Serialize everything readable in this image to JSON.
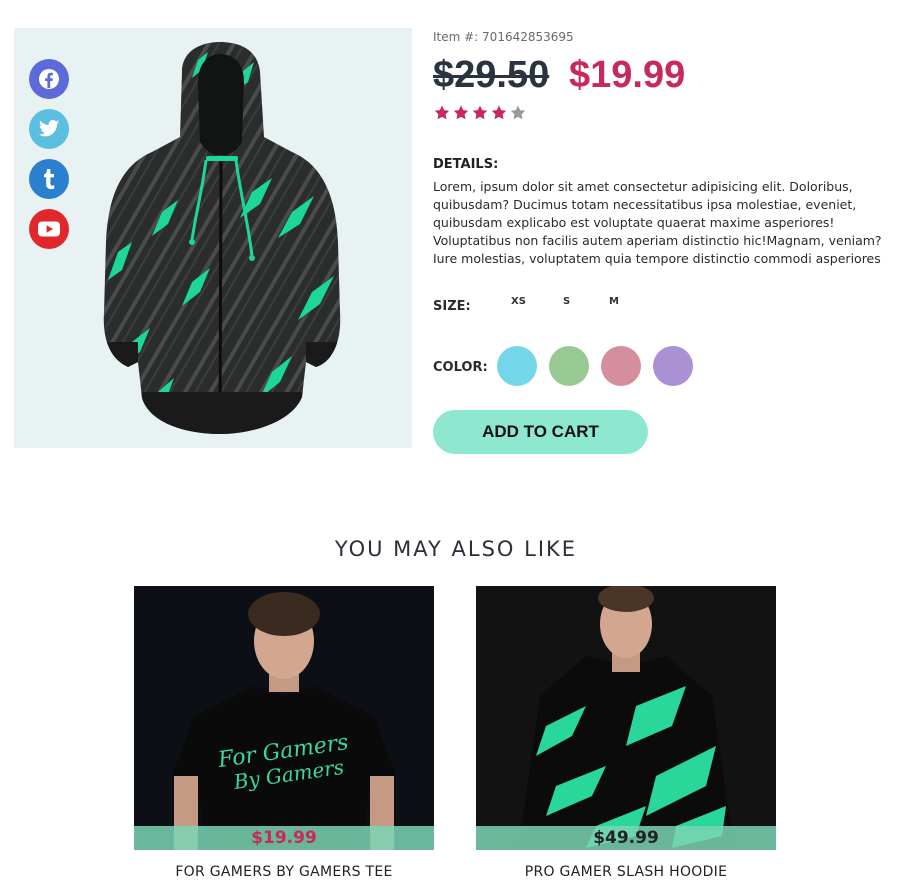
{
  "social": [
    {
      "name": "facebook-icon",
      "color": "#5c6bd9"
    },
    {
      "name": "twitter-icon",
      "color": "#5bbfe0"
    },
    {
      "name": "tumblr-icon",
      "color": "#2b7fcf"
    },
    {
      "name": "youtube-icon",
      "color": "#e0282c"
    }
  ],
  "product": {
    "item_number": "Item #: 701642853695",
    "old_price": "$29.50",
    "new_price": "$19.99",
    "rating": 4,
    "rating_max": 5,
    "details_heading": "DETAILS:",
    "details_text": "Lorem, ipsum dolor sit amet consectetur adipisicing elit. Doloribus, quibusdam? Ducimus totam necessitatibus ipsa molestiae, eveniet, quibusdam explicabo est voluptate quaerat maxime asperiores! Voluptatibus non facilis autem aperiam distinctio hic!Magnam, veniam? Iure molestias, voluptatem quia tempore distinctio commodi asperiores",
    "size_label": "SIZE:",
    "sizes": [
      "XS",
      "S",
      "M"
    ],
    "color_label": "COLOR:",
    "colors": [
      "#74d6e8",
      "#98c994",
      "#d48e9e",
      "#a991d4"
    ],
    "add_to_cart": "ADD TO CART"
  },
  "related": {
    "title": "YOU MAY ALSO LIKE",
    "items": [
      {
        "name": "FOR GAMERS BY GAMERS TEE",
        "price": "$19.99",
        "price_color": "#c8285a"
      },
      {
        "name": "PRO GAMER SLASH HOODIE",
        "price": "$49.99",
        "price_color": "#222222"
      }
    ]
  },
  "colors": {
    "accent": "#8de8cf",
    "sale": "#c8285a",
    "star": "#c8285a",
    "star_empty": "#9a9a9a"
  }
}
